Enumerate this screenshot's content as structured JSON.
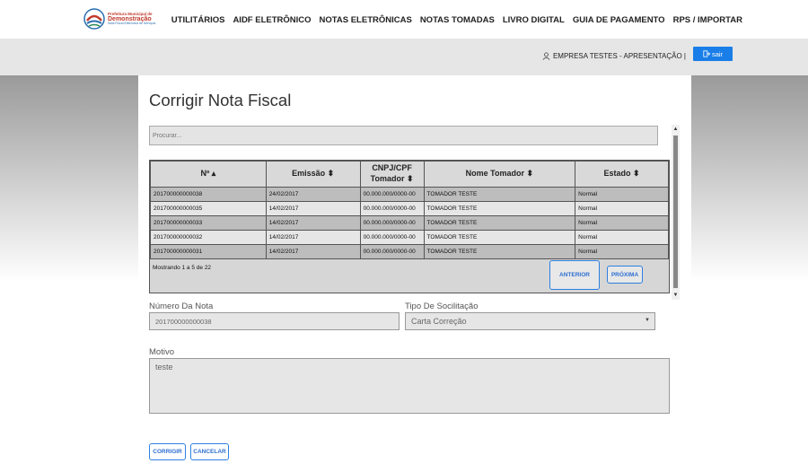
{
  "logo": {
    "line1": "Prefeitura Municipal de",
    "line2": "Demonstração",
    "line3": "Nota Fiscal Eletrônica de Serviços"
  },
  "nav": {
    "items": [
      {
        "label": "UTILITÁRIOS"
      },
      {
        "label": "AIDF ELETRÔNICO"
      },
      {
        "label": "NOTAS ELETRÔNICAS"
      },
      {
        "label": "NOTAS TOMADAS"
      },
      {
        "label": "LIVRO DIGITAL"
      },
      {
        "label": "GUIA DE PAGAMENTO"
      },
      {
        "label": "RPS / IMPORTAR"
      }
    ]
  },
  "userbar": {
    "user_label": "EMPRESA TESTES - APRESENTAÇÃO |",
    "logout_label": "sair"
  },
  "page": {
    "title": "Corrigir Nota Fiscal"
  },
  "search": {
    "placeholder": "Procurar..."
  },
  "table": {
    "headers": [
      {
        "label": "Nº ▴"
      },
      {
        "label": "Emissão ⬍"
      },
      {
        "label": "CNPJ/CPF Tomador ⬍"
      },
      {
        "label": "Nome Tomador ⬍"
      },
      {
        "label": "Estado ⬍"
      }
    ],
    "rows": [
      {
        "numero": "201700000000038",
        "emissao": "24/02/2017",
        "cnpj": "00.000.000/0000-00",
        "nome": "TOMADOR TESTE",
        "estado": "Normal"
      },
      {
        "numero": "201700000000035",
        "emissao": "14/02/2017",
        "cnpj": "00.000.000/0000-00",
        "nome": "TOMADOR TESTE",
        "estado": "Normal"
      },
      {
        "numero": "201700000000033",
        "emissao": "14/02/2017",
        "cnpj": "00.000.000/0000-00",
        "nome": "TOMADOR TESTE",
        "estado": "Normal"
      },
      {
        "numero": "201700000000032",
        "emissao": "14/02/2017",
        "cnpj": "00.000.000/0000-00",
        "nome": "TOMADOR TESTE",
        "estado": "Normal"
      },
      {
        "numero": "201700000000031",
        "emissao": "14/02/2017",
        "cnpj": "00.000.000/0000-00",
        "nome": "TOMADOR TESTE",
        "estado": "Normal"
      }
    ],
    "showing": "Mostrando 1 a 5 de 22",
    "prev_label": "ANTERIOR",
    "next_label": "PRÓXIMA"
  },
  "form": {
    "numero_label": "Número Da Nota",
    "numero_value": "201700000000038",
    "tipo_label": "Tipo De Socilitação",
    "tipo_value": "Carta Correção",
    "motivo_label": "Motivo",
    "motivo_value": "teste"
  },
  "actions": {
    "submit_label": "CORRIGIR",
    "cancel_label": "CANCELAR"
  },
  "colors": {
    "accent": "#1a7ee8",
    "logo_red": "#c0392b"
  }
}
